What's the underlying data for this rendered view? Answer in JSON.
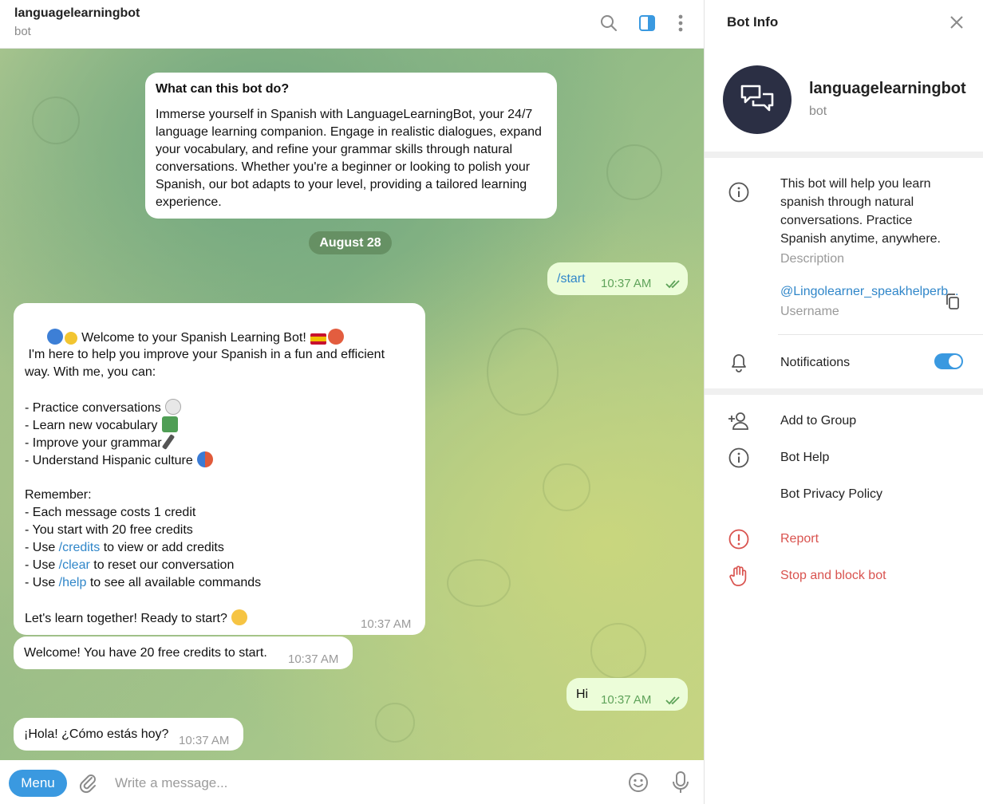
{
  "chat_header": {
    "title": "languagelearningbot",
    "subtitle": "bot",
    "icons": [
      "search-icon",
      "sidebar-toggle-icon",
      "more-icon"
    ]
  },
  "info_card": {
    "title": "What can this bot do?",
    "body": "Immerse yourself in Spanish with LanguageLearningBot, your 24/7 language learning companion. Engage in realistic dialogues, expand your vocabulary, and refine your grammar skills through natural conversations. Whether you're a beginner or looking to polish your Spanish, our bot adapts to your level, providing a tailored learning experience."
  },
  "date_separator": "August 28",
  "messages": {
    "start": {
      "text": "/start",
      "time": "10:37 AM"
    },
    "welcome": {
      "lines": [
        "Welcome to your Spanish Learning Bot!",
        "",
        " I'm here to help you improve your Spanish in a fun and efficient",
        "way. With me, you can:",
        "",
        "- Practice conversations",
        "- Learn new vocabulary",
        "- Improve your grammar",
        "- Understand Hispanic culture",
        "",
        "Remember:",
        "- Each message costs 1 credit",
        "- You start with 20 free credits",
        "- Use ",
        "- Use ",
        "- Use ",
        "",
        "Let's learn together! Ready to start?"
      ],
      "cmd_credits": "/credits",
      "cmd_credits_suffix": " to view or add credits",
      "cmd_clear": "/clear",
      "cmd_clear_suffix": " to reset our conversation",
      "cmd_help": "/help",
      "cmd_help_suffix": " to see all available commands",
      "time": "10:37 AM"
    },
    "credits": {
      "text": "Welcome! You have 20 free credits to start.",
      "time": "10:37 AM"
    },
    "hi": {
      "text": "Hi",
      "time": "10:37 AM"
    },
    "hola": {
      "text": "¡Hola! ¿Cómo estás hoy?",
      "time": "10:37 AM"
    }
  },
  "composer": {
    "menu_label": "Menu",
    "placeholder": "Write a message..."
  },
  "panel": {
    "title": "Bot Info",
    "bot_name": "languagelearningbot",
    "bot_sub": "bot",
    "description": "This bot will help you learn spanish through natural conversations. Practice Spanish anytime, anywhere.",
    "description_label": "Description",
    "username": "@Lingolearner_speakhelperb...",
    "username_label": "Username",
    "notifications_label": "Notifications",
    "notifications_on": true,
    "actions": {
      "add_to_group": "Add to Group",
      "bot_help": "Bot Help",
      "privacy": "Bot Privacy Policy",
      "report": "Report",
      "stop": "Stop and block bot"
    }
  },
  "colors": {
    "accent": "#3a99e0",
    "danger": "#d9534f",
    "outgoing_bubble": "#ecfdd9"
  }
}
